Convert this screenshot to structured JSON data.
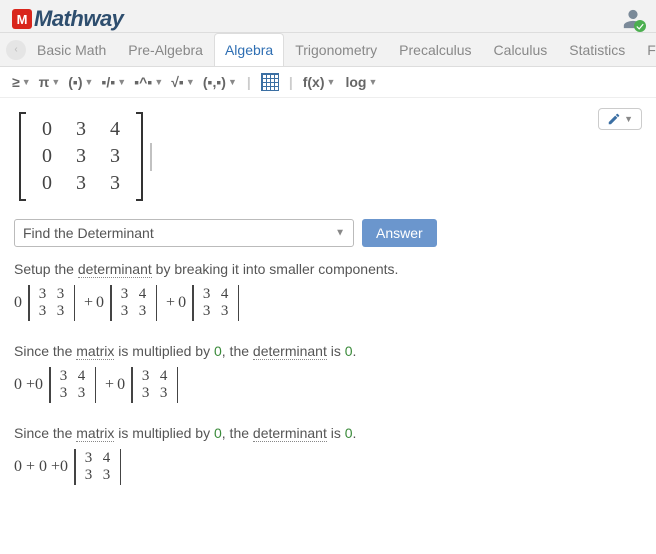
{
  "brand": {
    "badge": "M",
    "name": "Mathway"
  },
  "tabs": [
    "Basic Math",
    "Pre-Algebra",
    "Algebra",
    "Trigonometry",
    "Precalculus",
    "Calculus",
    "Statistics",
    "Finite Math"
  ],
  "active_tab": 2,
  "toolbar": {
    "items": [
      "≥",
      "π",
      "(▪)",
      "▪/▪",
      "▪^▪",
      "√▪",
      "(▪,▪)"
    ],
    "fx": "f(x)",
    "log": "log"
  },
  "matrix": {
    "rows": [
      [
        "0",
        "3",
        "4"
      ],
      [
        "0",
        "3",
        "3"
      ],
      [
        "0",
        "3",
        "3"
      ]
    ]
  },
  "operation": {
    "selected": "Find the Determinant",
    "button": "Answer"
  },
  "steps": [
    {
      "pre": "Setup the ",
      "term": "determinant",
      "post": " by breaking it into smaller components.",
      "math": [
        {
          "type": "coef",
          "val": "0"
        },
        {
          "type": "det2",
          "cells": [
            "3",
            "3",
            "3",
            "3"
          ]
        },
        {
          "type": "plus"
        },
        {
          "type": "coef",
          "val": "0"
        },
        {
          "type": "det2",
          "cells": [
            "3",
            "4",
            "3",
            "3"
          ]
        },
        {
          "type": "plus"
        },
        {
          "type": "coef",
          "val": "0"
        },
        {
          "type": "det2",
          "cells": [
            "3",
            "4",
            "3",
            "3"
          ]
        }
      ]
    },
    {
      "pre": "Since the ",
      "term": "matrix",
      "mid": " is multiplied by ",
      "zero1": "0",
      "mid2": ", the ",
      "term2": "determinant",
      "mid3": " is ",
      "zero2": "0",
      "post": ".",
      "math": [
        {
          "type": "text",
          "val": "0 + "
        },
        {
          "type": "coef",
          "val": "0"
        },
        {
          "type": "det2",
          "cells": [
            "3",
            "4",
            "3",
            "3"
          ]
        },
        {
          "type": "plus"
        },
        {
          "type": "coef",
          "val": "0"
        },
        {
          "type": "det2",
          "cells": [
            "3",
            "4",
            "3",
            "3"
          ]
        }
      ]
    },
    {
      "pre": "Since the ",
      "term": "matrix",
      "mid": " is multiplied by ",
      "zero1": "0",
      "mid2": ", the ",
      "term2": "determinant",
      "mid3": " is ",
      "zero2": "0",
      "post": ".",
      "math": [
        {
          "type": "text",
          "val": "0 + 0 + "
        },
        {
          "type": "coef",
          "val": "0"
        },
        {
          "type": "det2",
          "cells": [
            "3",
            "4",
            "3",
            "3"
          ]
        }
      ]
    }
  ]
}
